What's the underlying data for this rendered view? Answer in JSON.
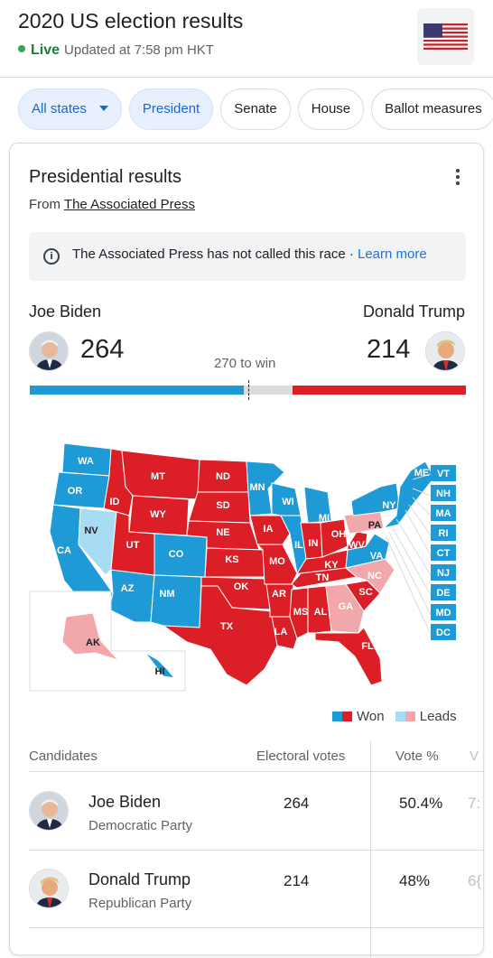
{
  "header": {
    "title": "2020 US election results",
    "live_label": "Live",
    "updated": "Updated at 7:58 pm HKT",
    "flag_icon": "us-flag-icon"
  },
  "filters": {
    "state_dropdown": "All states",
    "chips": [
      "President",
      "Senate",
      "House",
      "Ballot measures"
    ]
  },
  "card": {
    "title": "Presidential results",
    "source_prefix": "From",
    "source_name": "The Associated Press",
    "notice": "The Associated Press has not called this race · ",
    "learn_more": "Learn more"
  },
  "race": {
    "left": {
      "name": "Joe Biden",
      "votes": "264",
      "color": "#1e9bd7"
    },
    "right": {
      "name": "Donald Trump",
      "votes": "214",
      "color": "#dc1f26"
    },
    "to_win": "270 to win",
    "total_electoral": 538,
    "left_fraction": 0.4907,
    "right_fraction": 0.3978
  },
  "map": {
    "colors": {
      "dem_won": "#1e9bd7",
      "dem_leads": "#a8dcf2",
      "rep_won": "#dc1f26",
      "rep_leads": "#f2a7ab"
    },
    "state_labels": [
      "WA",
      "OR",
      "CA",
      "NV",
      "ID",
      "MT",
      "WY",
      "UT",
      "AZ",
      "CO",
      "NM",
      "ND",
      "SD",
      "NE",
      "KS",
      "OK",
      "TX",
      "MN",
      "IA",
      "MO",
      "AR",
      "LA",
      "WI",
      "IL",
      "MI",
      "IN",
      "OH",
      "KY",
      "TN",
      "MS",
      "AL",
      "GA",
      "FL",
      "SC",
      "NC",
      "VA",
      "WV",
      "PA",
      "NY",
      "ME",
      "AK",
      "HI"
    ],
    "side_labels": [
      "VT",
      "NH",
      "MA",
      "RI",
      "CT",
      "NJ",
      "DE",
      "MD",
      "DC"
    ]
  },
  "legend": {
    "won": "Won",
    "leads": "Leads"
  },
  "table": {
    "headers": [
      "Candidates",
      "Electoral votes",
      "Vote %",
      "V"
    ],
    "rows": [
      {
        "name": "Joe Biden",
        "party": "Democratic Party",
        "electoral": "264",
        "pct": "50.4%",
        "extra": "7:"
      },
      {
        "name": "Donald Trump",
        "party": "Republican Party",
        "electoral": "214",
        "pct": "48%",
        "extra": "6{"
      }
    ]
  }
}
